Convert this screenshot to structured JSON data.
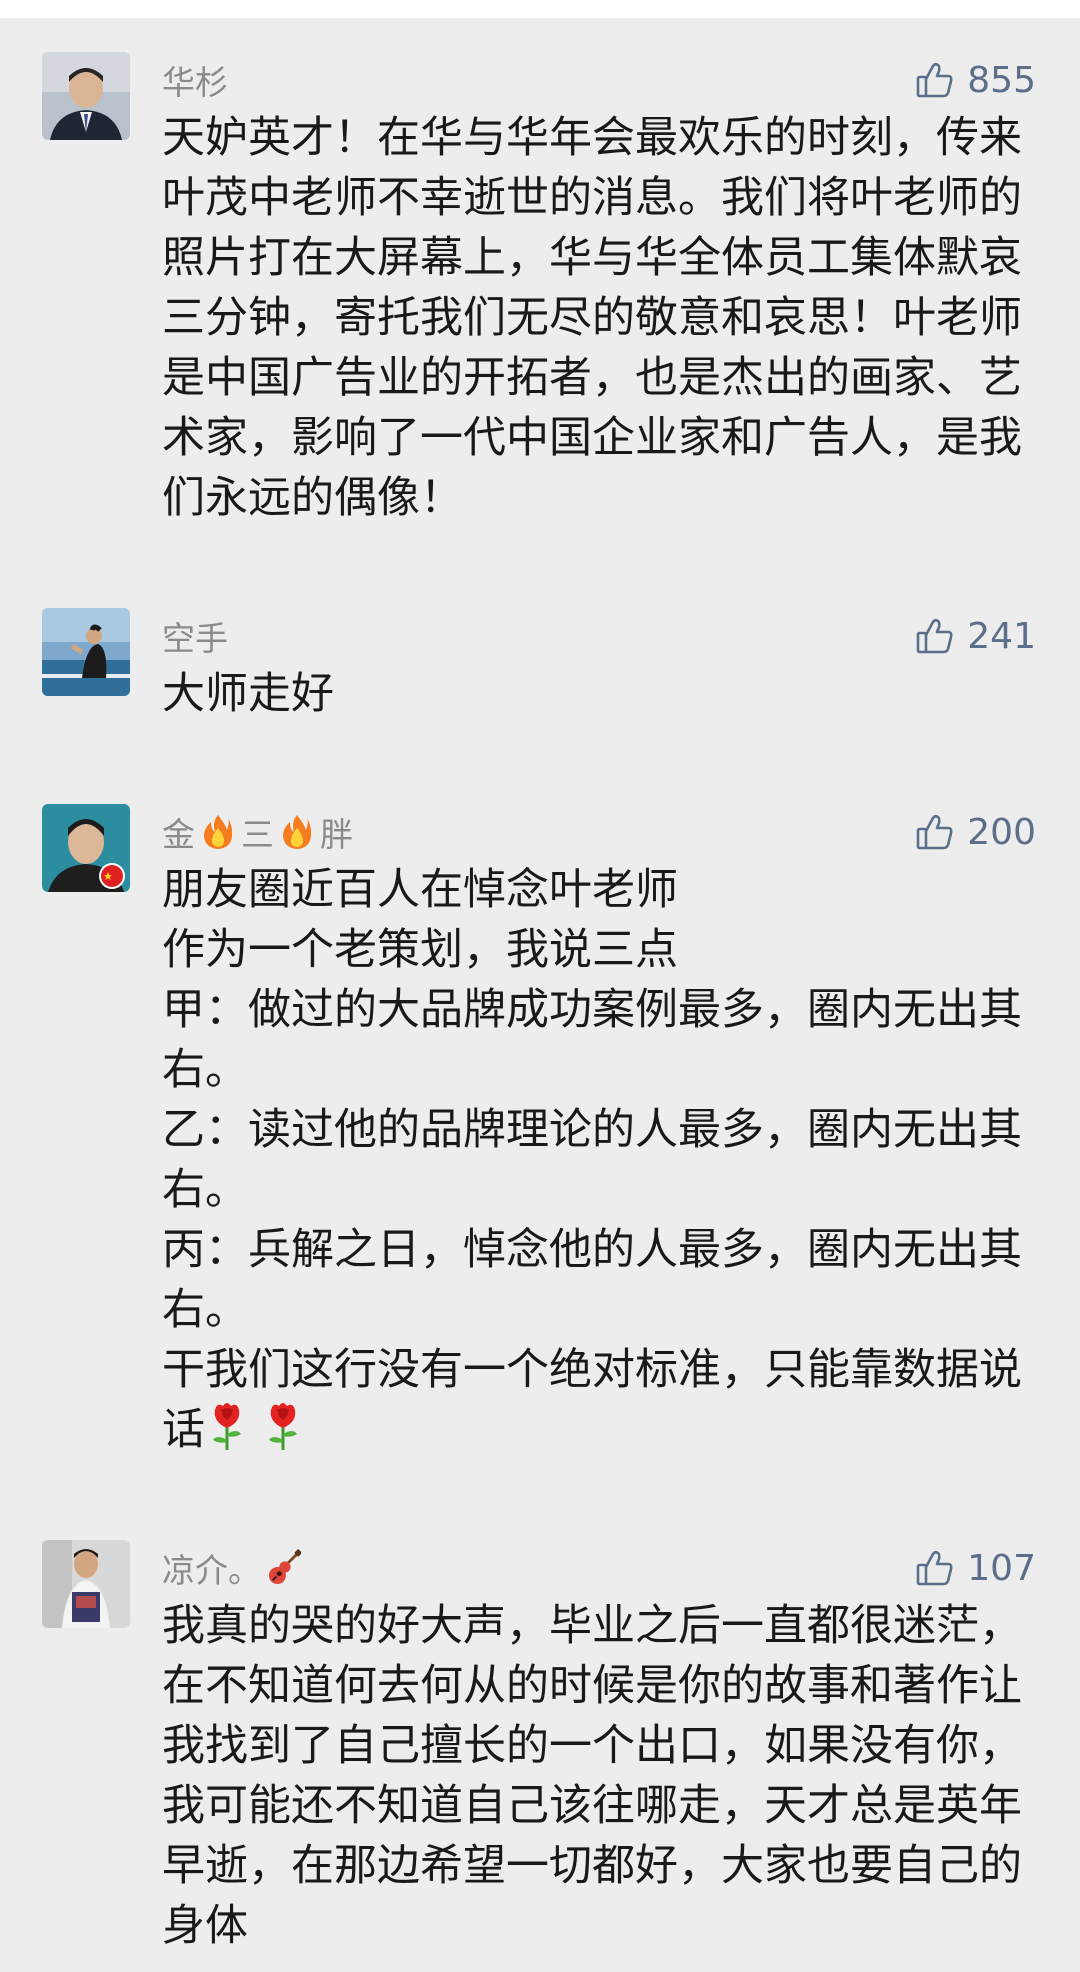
{
  "comments": [
    {
      "name": "华杉",
      "likes": "855",
      "text": "天妒英才！在华与华年会最欢乐的时刻，传来叶茂中老师不幸逝世的消息。我们将叶老师的照片打在大屏幕上，华与华全体员工集体默哀三分钟，寄托我们无尽的敬意和哀思！叶老师是中国广告业的开拓者，也是杰出的画家、艺术家，影响了一代中国企业家和广告人，是我们永远的偶像！"
    },
    {
      "name": "空手",
      "likes": "241",
      "text": "大师走好"
    },
    {
      "name_parts": [
        "金",
        "三",
        "胖"
      ],
      "name_emoji": "fire-icon",
      "likes": "200",
      "lines": [
        "朋友圈近百人在悼念叶老师",
        "作为一个老策划，我说三点",
        "甲：做过的大品牌成功案例最多，圈内无出其右。",
        "乙：读过他的品牌理论的人最多，圈内无出其右。",
        "丙：兵解之日，悼念他的人最多，圈内无出其右。",
        "干我们这行没有一个绝对标准，只能靠数据说话"
      ],
      "trailing_emoji": "rose-icon"
    },
    {
      "name": "凉介。",
      "name_emoji": "guitar-icon",
      "likes": "107",
      "text": "我真的哭的好大声，毕业之后一直都很迷茫，在不知道何去何从的时候是你的故事和著作让我找到了自己擅长的一个出口，如果没有你，我可能还不知道自己该往哪走，天才总是英年早逝，在那边希望一切都好，大家也要自己的身体"
    }
  ],
  "colors": {
    "background": "#ededed",
    "name": "#8a8a8a",
    "like": "#5b6e8a",
    "text": "#191919"
  }
}
